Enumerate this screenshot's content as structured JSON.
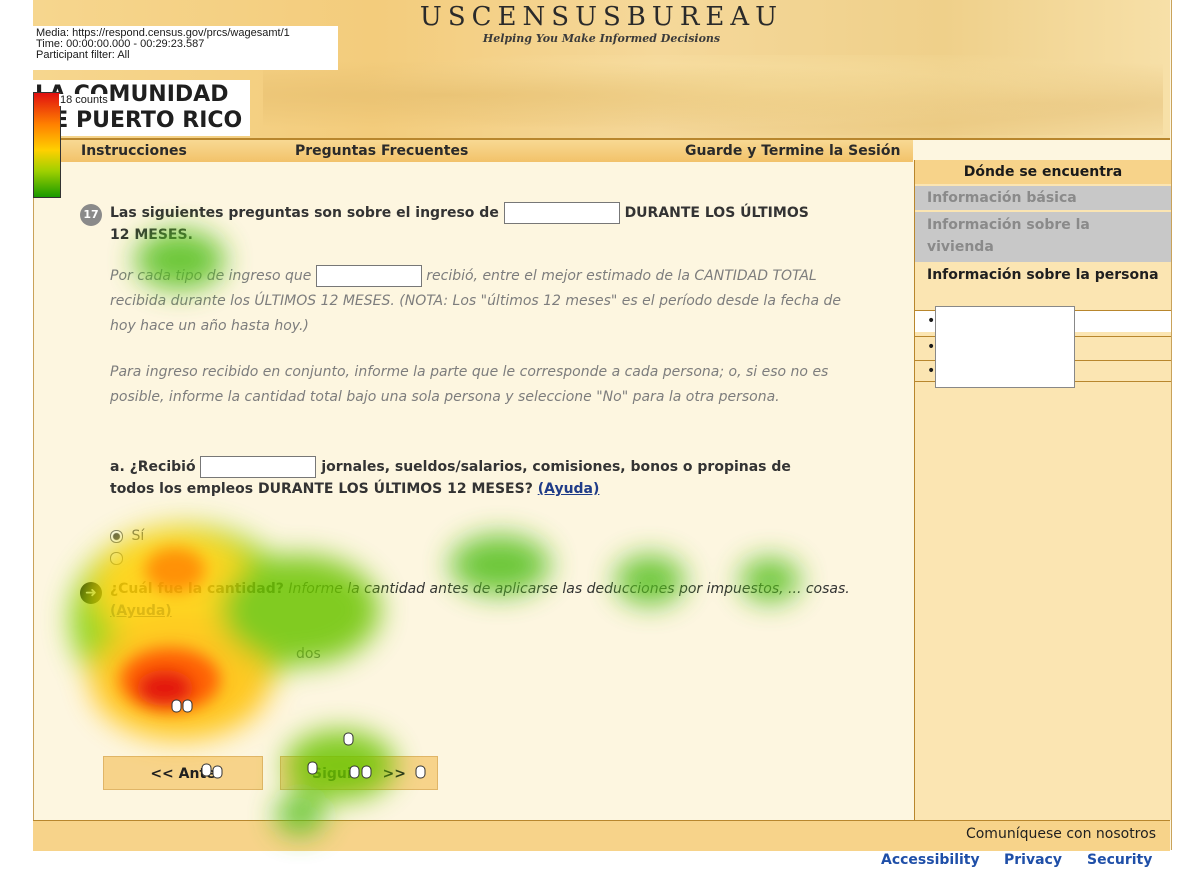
{
  "recording": {
    "media": "Media: https://respond.census.gov/prcs/wagesamt/1",
    "time": "Time: 00:00:00.000 - 00:29:23.587",
    "filter": "Participant filter: All",
    "legend_count": "18 counts"
  },
  "header": {
    "agency": "USCENSUSBUREAU",
    "tagline": "Helping You Make Informed Decisions",
    "site_title_line1": "LA COMUNIDAD",
    "site_title_line2": "DE PUERTO RICO"
  },
  "nav": {
    "instructions": "Instrucciones",
    "faq": "Preguntas Frecuentes",
    "save_exit": "Guarde y Termine la Sesión"
  },
  "sidebar": {
    "title": "Dónde se encuentra",
    "items": [
      {
        "label": "Información básica",
        "state": "done"
      },
      {
        "label": "Información sobre la vivienda",
        "state": "done"
      },
      {
        "label": "Información sobre la persona",
        "state": "current"
      }
    ],
    "sub_bullets": [
      "•",
      "•",
      "•"
    ]
  },
  "question": {
    "number": "17",
    "intro_pre": "Las siguientes preguntas son sobre el ingreso de",
    "intro_post": "DURANTE LOS ÚLTIMOS 12 MESES.",
    "instr1_pre": "Por cada tipo de ingreso que",
    "instr1_post": "recibió, entre el mejor estimado de la CANTIDAD TOTAL recibida durante los ÚLTIMOS 12 MESES. (NOTA: Los \"últimos 12 meses\" es el período desde la fecha de hoy hace un año hasta hoy.)",
    "instr2": "Para ingreso recibido en conjunto, informe la parte que le corresponde a cada persona; o, si eso no es posible, informe la cantidad total bajo una sola persona y seleccione \"No\" para la otra persona.",
    "part_a_pre": "a. ¿Recibió",
    "part_a_post": "jornales, sueldos/salarios, comisiones, bonos o propinas de todos los empleos DURANTE LOS ÚLTIMOS 12 MESES?",
    "help_label": "(Ayuda)",
    "option_yes": "Sí",
    "amount_bold": "¿Cuál fue la cantidad?",
    "amount_italic": "Informe la cantidad antes de aplicarse las deducciones por impuestos, ... cosas.",
    "amount_help": "(Ayuda)",
    "dollars_fragment": "dos"
  },
  "buttons": {
    "previous": "<<  Ante",
    "next": "Sigui",
    "next_arrows": ">>"
  },
  "footer": {
    "contact": "Comuníquese con nosotros",
    "links": [
      "Accessibility",
      "Privacy",
      "Security"
    ]
  },
  "colors": {
    "banner": "#f5d48a",
    "page_bg": "#fdf6e0",
    "link": "#1f4fa8"
  }
}
